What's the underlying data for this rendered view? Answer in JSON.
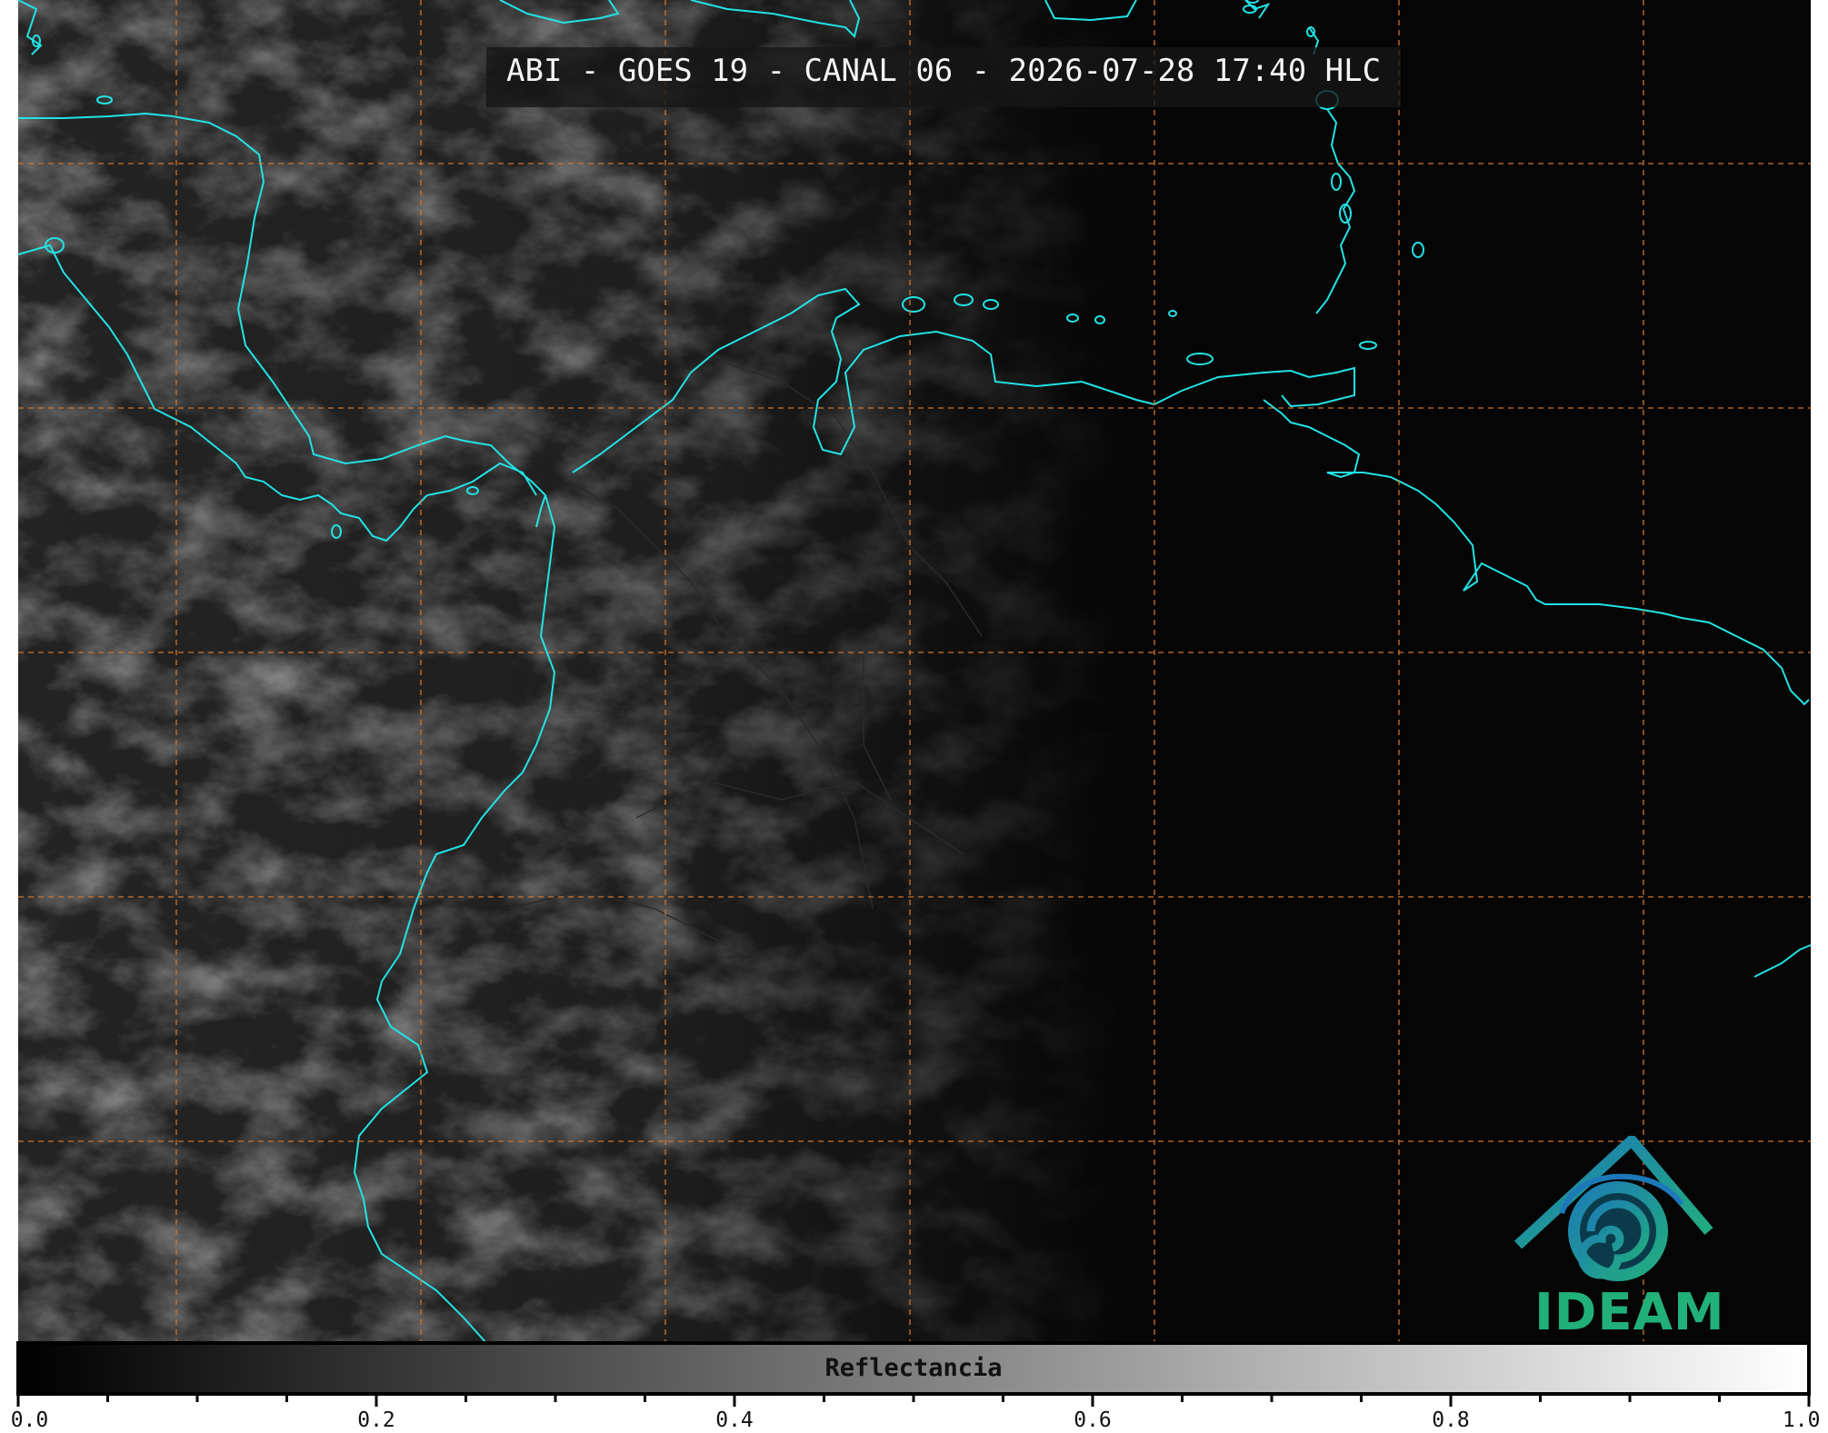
{
  "title": "ABI - GOES 19 - CANAL 06 - 2026-07-28 17:40 HLC",
  "colorbar": {
    "label": "Reflectancia",
    "min": 0.0,
    "max": 1.0,
    "ticks": [
      "0.0",
      "0.2",
      "0.4",
      "0.6",
      "0.8",
      "1.0"
    ],
    "gradient_start": "#000000",
    "gradient_end": "#ffffff"
  },
  "logo": {
    "text": "IDEAM",
    "colors": [
      "#1c78b8",
      "#22b07a"
    ]
  },
  "colors": {
    "coastline": "#22e3e6",
    "border": "#2a2a2a",
    "grid": "#d2742a",
    "background": "#050505"
  },
  "icons": [
    "ideam-logo-icon"
  ]
}
